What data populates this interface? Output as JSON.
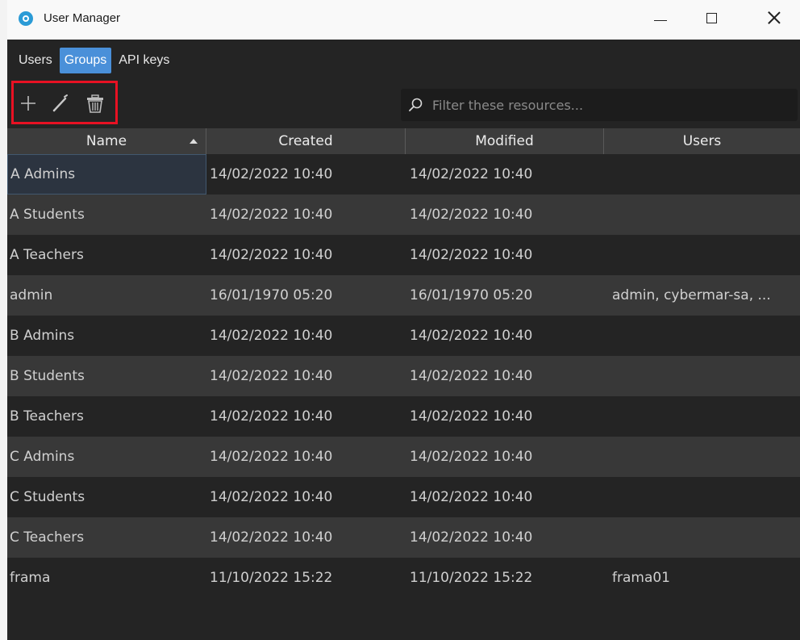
{
  "window": {
    "title": "User Manager",
    "icon": "app-logo-icon",
    "controls": [
      "minimize-icon",
      "maximize-icon",
      "close-icon"
    ]
  },
  "tabs": [
    {
      "label": "Users",
      "active": false
    },
    {
      "label": "Groups",
      "active": true
    },
    {
      "label": "API keys",
      "active": false
    }
  ],
  "toolbar": {
    "buttons": [
      "add-icon",
      "edit-icon",
      "delete-icon"
    ]
  },
  "search": {
    "placeholder": "Filter these resources...",
    "value": ""
  },
  "table": {
    "columns": [
      "Name",
      "Created",
      "Modified",
      "Users"
    ],
    "sort_column": "Name",
    "sort_direction": "ascending",
    "rows": [
      {
        "name": "A Admins",
        "created": "14/02/2022 10:40",
        "modified": "14/02/2022 10:40",
        "users": ""
      },
      {
        "name": "A Students",
        "created": "14/02/2022 10:40",
        "modified": "14/02/2022 10:40",
        "users": ""
      },
      {
        "name": "A Teachers",
        "created": "14/02/2022 10:40",
        "modified": "14/02/2022 10:40",
        "users": ""
      },
      {
        "name": "admin",
        "created": "16/01/1970 05:20",
        "modified": "16/01/1970 05:20",
        "users": "admin, cybermar-sa, ..."
      },
      {
        "name": "B Admins",
        "created": "14/02/2022 10:40",
        "modified": "14/02/2022 10:40",
        "users": ""
      },
      {
        "name": "B Students",
        "created": "14/02/2022 10:40",
        "modified": "14/02/2022 10:40",
        "users": ""
      },
      {
        "name": "B Teachers",
        "created": "14/02/2022 10:40",
        "modified": "14/02/2022 10:40",
        "users": ""
      },
      {
        "name": "C Admins",
        "created": "14/02/2022 10:40",
        "modified": "14/02/2022 10:40",
        "users": ""
      },
      {
        "name": "C Students",
        "created": "14/02/2022 10:40",
        "modified": "14/02/2022 10:40",
        "users": ""
      },
      {
        "name": "C Teachers",
        "created": "14/02/2022 10:40",
        "modified": "14/02/2022 10:40",
        "users": ""
      },
      {
        "name": "frama",
        "created": "11/10/2022 15:22",
        "modified": "11/10/2022 15:22",
        "users": "frama01"
      }
    ]
  },
  "colors": {
    "accent": "#4a90d9",
    "highlight_box": "#e81123",
    "background": "#242424",
    "row_alt": "#383838"
  }
}
